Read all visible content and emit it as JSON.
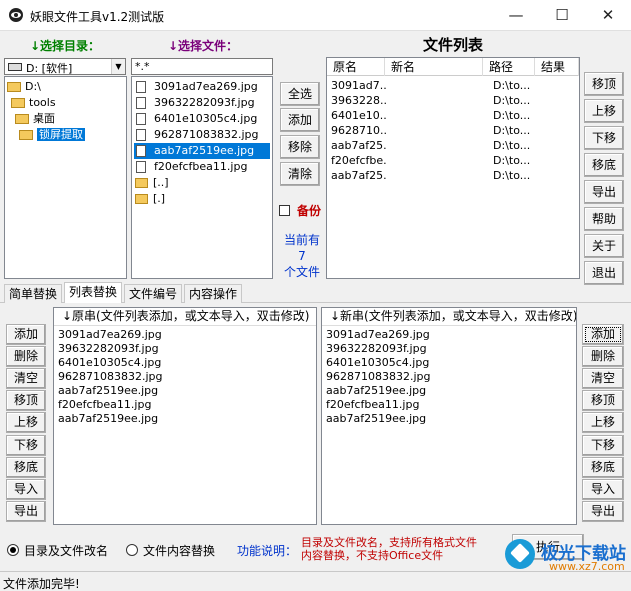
{
  "window": {
    "title": "妖眼文件工具v1.2测试版",
    "min_glyph": "—",
    "max_glyph": "☐",
    "close_glyph": "✕"
  },
  "left": {
    "select_dir_label": "↓选择目录：",
    "select_file_label": "↓选择文件：",
    "drive_value": "D: [软件]",
    "tree": [
      "D:\\",
      "tools",
      "桌面",
      "锁屏提取"
    ],
    "tree_selected": "锁屏提取",
    "filter_value": "*.*",
    "files": [
      "3091ad7ea269.jpg",
      "39632282093f.jpg",
      "6401e10305c4.jpg",
      "962871083832.jpg",
      "aab7af2519ee.jpg",
      "f20efcfbea11.jpg",
      "[..]",
      "[.]"
    ],
    "file_selected": "aab7af2519ee.jpg"
  },
  "middle": {
    "buttons": [
      "全选",
      "添加",
      "移除",
      "清除"
    ],
    "backup_label": "备份",
    "backup_checked": false,
    "count_text": "当前有\n7\n个文件"
  },
  "filelist": {
    "title": "文件列表",
    "columns": [
      "原名",
      "新名",
      "路径",
      "结果"
    ],
    "rows": [
      {
        "orig": "3091ad7...",
        "new": "",
        "path": "D:\\to...",
        "result": ""
      },
      {
        "orig": "3963228...",
        "new": "",
        "path": "D:\\to...",
        "result": ""
      },
      {
        "orig": "6401e10...",
        "new": "",
        "path": "D:\\to...",
        "result": ""
      },
      {
        "orig": "9628710...",
        "new": "",
        "path": "D:\\to...",
        "result": ""
      },
      {
        "orig": "aab7af25...",
        "new": "",
        "path": "D:\\to...",
        "result": ""
      },
      {
        "orig": "f20efcfbe...",
        "new": "",
        "path": "D:\\to...",
        "result": ""
      },
      {
        "orig": "aab7af25...",
        "new": "",
        "path": "D:\\to...",
        "result": ""
      }
    ],
    "right_buttons": [
      "移顶",
      "上移",
      "下移",
      "移底",
      "导出",
      "帮助",
      "关于",
      "退出"
    ]
  },
  "tabs": [
    "简单替换",
    "列表替换",
    "文件编号",
    "内容操作"
  ],
  "active_tab": "列表替换",
  "list_replace": {
    "left_buttons": [
      "添加",
      "删除",
      "清空",
      "移顶",
      "上移",
      "下移",
      "移底",
      "导入",
      "导出"
    ],
    "right_buttons": [
      "添加",
      "删除",
      "清空",
      "移顶",
      "上移",
      "下移",
      "移底",
      "导入",
      "导出"
    ],
    "orig_header": "↓原串(文件列表添加，或文本导入，双击修改)",
    "new_header": "↓新串(文件列表添加，或文本导入，双击修改)",
    "orig_rows": [
      "3091ad7ea269.jpg",
      "39632282093f.jpg",
      "6401e10305c4.jpg",
      "962871083832.jpg",
      "aab7af2519ee.jpg",
      "f20efcfbea11.jpg",
      "aab7af2519ee.jpg"
    ],
    "new_rows": [
      "3091ad7ea269.jpg",
      "39632282093f.jpg",
      "6401e10305c4.jpg",
      "962871083832.jpg",
      "aab7af2519ee.jpg",
      "f20efcfbea11.jpg",
      "aab7af2519ee.jpg"
    ]
  },
  "bottom": {
    "radio1": "目录及文件改名",
    "radio2": "文件内容替换",
    "radio_selected": "目录及文件改名",
    "func_label": "功能说明：",
    "func_desc_line1": "目录及文件改名，支持所有格式文件",
    "func_desc_line2": "内容替换，不支持Office文件",
    "exec_label": "执行"
  },
  "watermark": {
    "line1": "极光下载站",
    "line2": "www.xz7.com"
  },
  "status": "文件添加完毕!"
}
